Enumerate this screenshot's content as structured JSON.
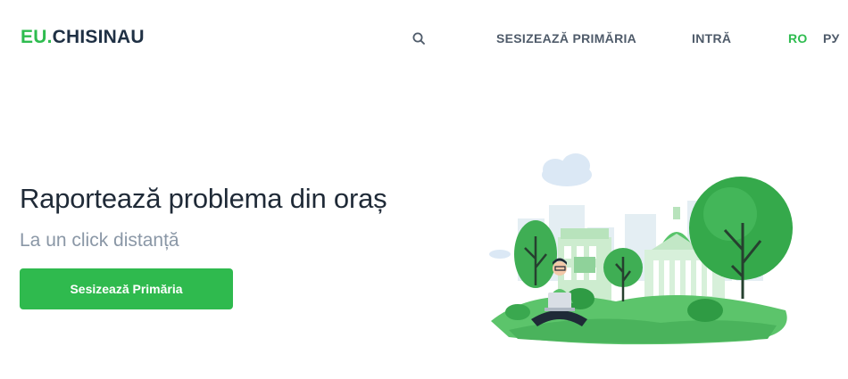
{
  "header": {
    "logo_part1": "EU.",
    "logo_part2": "CHISINAU",
    "search_icon": "search-icon",
    "nav_report": "SESIZEAZĂ PRIMĂRIA",
    "nav_login": "INTRĂ",
    "lang_ro": "RO",
    "lang_ru": "РУ"
  },
  "hero": {
    "title": "Raportează problema din oraș",
    "subtitle": "La un click distanță",
    "cta_label": "Sesizează Primăria"
  },
  "colors": {
    "brand_green": "#2ebc4f",
    "brand_dark": "#1f3044",
    "nav_text": "#4f5b6a",
    "subtitle_gray": "#8a97a6"
  }
}
